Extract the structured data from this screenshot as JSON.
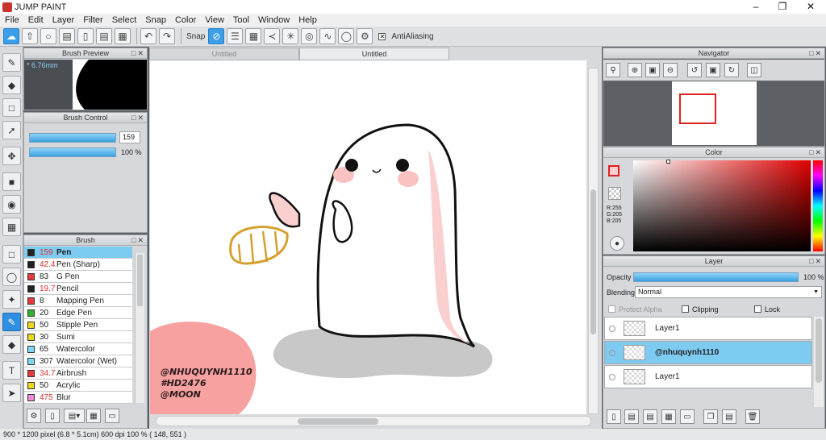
{
  "app": {
    "title": "JUMP PAINT"
  },
  "menu": [
    "File",
    "Edit",
    "Layer",
    "Filter",
    "Select",
    "Snap",
    "Color",
    "View",
    "Tool",
    "Window",
    "Help"
  ],
  "toolbar": {
    "snap_label": "Snap",
    "antialias_label": "AntiAliasing"
  },
  "brush_preview": {
    "title": "Brush Preview",
    "size_text": "* 6.76mm"
  },
  "brush_control": {
    "title": "Brush Control",
    "size_value": "159",
    "opacity_value": "100 %"
  },
  "brush_panel": {
    "title": "Brush",
    "items": [
      {
        "size": "159",
        "name": "Pen",
        "color": "#222222",
        "size_red": true,
        "selected": true
      },
      {
        "size": "42.4",
        "name": "Pen (Sharp)",
        "color": "#222222",
        "size_red": true
      },
      {
        "size": "83",
        "name": "G Pen",
        "color": "#e23b3b",
        "size_red": false
      },
      {
        "size": "19.7",
        "name": "Pencil",
        "color": "#222222",
        "size_red": true
      },
      {
        "size": "8",
        "name": "Mapping Pen",
        "color": "#e23b3b",
        "size_red": false
      },
      {
        "size": "20",
        "name": "Edge Pen",
        "color": "#2cb52c",
        "size_red": false
      },
      {
        "size": "50",
        "name": "Stipple Pen",
        "color": "#e8d820",
        "size_red": false
      },
      {
        "size": "30",
        "name": "Sumi",
        "color": "#e8d820",
        "size_red": false
      },
      {
        "size": "65",
        "name": "Watercolor",
        "color": "#7fd6f0",
        "size_red": false
      },
      {
        "size": "307",
        "name": "Watercolor (Wet)",
        "color": "#7fd6f0",
        "size_red": false
      },
      {
        "size": "34.7",
        "name": "Airbrush",
        "color": "#e23b3b",
        "size_red": true
      },
      {
        "size": "50",
        "name": "Acrylic",
        "color": "#e8d820",
        "size_red": false
      },
      {
        "size": "475",
        "name": "Blur",
        "color": "#f08ad8",
        "size_red": true
      }
    ]
  },
  "tabs": [
    "Untitled",
    "Untitled"
  ],
  "canvas_text": {
    "line1": "@NHUQUYNH1110",
    "line2": "#HD2476",
    "line3": "@MOON"
  },
  "navigator": {
    "title": "Navigator"
  },
  "color_panel": {
    "title": "Color",
    "r": "R:255",
    "g": "G:205",
    "b": "B:205"
  },
  "layer_panel": {
    "title": "Layer",
    "opacity_label": "Opacity",
    "opacity_value": "100 %",
    "blending_label": "Blending",
    "blending_value": "Normal",
    "protect_alpha": "Protect Alpha",
    "clipping": "Clipping",
    "lock": "Lock",
    "layers": [
      {
        "name": "Layer1",
        "selected": false
      },
      {
        "name": "@nhuquynh1110",
        "selected": true
      },
      {
        "name": "Layer1",
        "selected": false
      }
    ]
  },
  "status": {
    "text": "900 * 1200 pixel   (6.8 * 5.1cm)   600 dpi   100 %   ( 148, 551 )"
  },
  "colors": {
    "accent": "#3c9ee8",
    "selection": "#7ecbf2",
    "fg_color": "#ffcdcd"
  }
}
